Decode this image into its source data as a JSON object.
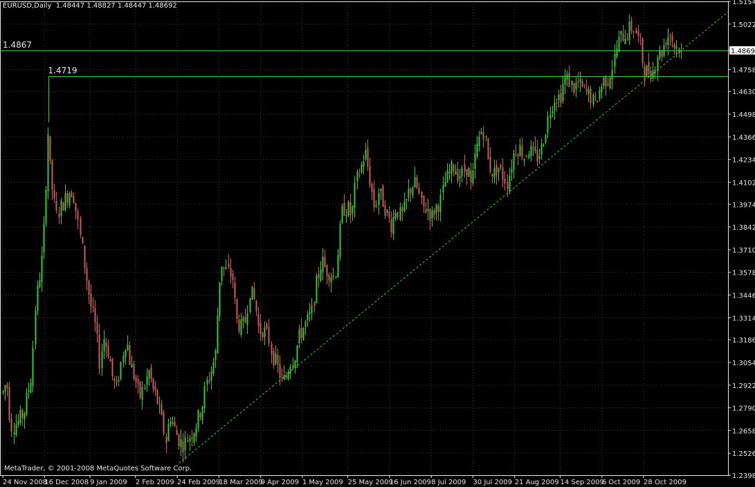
{
  "header": {
    "symbol": "EURUSD,Daily",
    "ohlc": "1.48447 1.48827 1.48447 1.48692"
  },
  "footer": {
    "copyright": "MetaTrader, © 2001-2008 MetaQuotes Software Corp."
  },
  "colors": {
    "background": "#000000",
    "grid": "#3a3a3a",
    "axis_text": "#e8e8e8",
    "bull_candle": "#32cd32",
    "bear_candle": "#d45a5a",
    "level_line": "#2fd62f",
    "trendline": "#2fd62f"
  },
  "chart_data": {
    "type": "candlestick",
    "symbol": "EURUSD",
    "timeframe": "Daily",
    "ylim": [
      1.2398,
      1.5154
    ],
    "current_price": "1.48692",
    "grid": true,
    "y_ticks": [
      "1.51540",
      "1.50220",
      "1.48692",
      "1.47580",
      "1.46300",
      "1.44980",
      "1.43660",
      "1.42340",
      "1.41020",
      "1.39740",
      "1.38420",
      "1.37100",
      "1.35780",
      "1.34460",
      "1.33140",
      "1.31860",
      "1.30540",
      "1.29220",
      "1.27900",
      "1.26580",
      "1.25260",
      "1.23980"
    ],
    "x_ticks": [
      "24 Nov 2008",
      "16 Dec 2008",
      "9 Jan 2009",
      "2 Feb 2009",
      "24 Feb 2009",
      "18 Mar 2009",
      "9 Apr 2009",
      "1 May 2009",
      "25 May 2009",
      "16 Jun 2009",
      "8 Jul 2009",
      "30 Jul 2009",
      "21 Aug 2009",
      "14 Sep 2009",
      "6 Oct 2009",
      "28 Oct 2009"
    ],
    "horizontal_levels": [
      {
        "label": "1.4867",
        "value": 1.4867,
        "from_date": "24 Nov 2008"
      },
      {
        "label": "1.4719",
        "value": 1.4719,
        "from_date": "18 Dec 2008"
      }
    ],
    "trendline": {
      "style": "dashed",
      "start": {
        "date": "25 Feb 2009",
        "price": 1.2468
      },
      "end": {
        "date": "17 Nov 2009",
        "price": 1.487
      }
    },
    "close_path": [
      [
        "24 Nov 2008",
        1.288
      ],
      [
        "26 Nov 2008",
        1.295
      ],
      [
        "28 Nov 2008",
        1.268
      ],
      [
        "2 Dec 2008",
        1.271
      ],
      [
        "5 Dec 2008",
        1.276
      ],
      [
        "9 Dec 2008",
        1.298
      ],
      [
        "11 Dec 2008",
        1.338
      ],
      [
        "15 Dec 2008",
        1.37
      ],
      [
        "17 Dec 2008",
        1.42
      ],
      [
        "18 Dec 2008",
        1.445
      ],
      [
        "19 Dec 2008",
        1.415
      ],
      [
        "22 Dec 2008",
        1.39
      ],
      [
        "24 Dec 2008",
        1.395
      ],
      [
        "29 Dec 2008",
        1.405
      ],
      [
        "31 Dec 2008",
        1.405
      ],
      [
        "2 Jan 2009",
        1.39
      ],
      [
        "5 Jan 2009",
        1.37
      ],
      [
        "7 Jan 2009",
        1.355
      ],
      [
        "9 Jan 2009",
        1.34
      ],
      [
        "12 Jan 2009",
        1.325
      ],
      [
        "14 Jan 2009",
        1.305
      ],
      [
        "16 Jan 2009",
        1.32
      ],
      [
        "19 Jan 2009",
        1.31
      ],
      [
        "21 Jan 2009",
        1.295
      ],
      [
        "23 Jan 2009",
        1.29
      ],
      [
        "26 Jan 2009",
        1.31
      ],
      [
        "28 Jan 2009",
        1.32
      ],
      [
        "30 Jan 2009",
        1.305
      ],
      [
        "2 Feb 2009",
        1.295
      ],
      [
        "4 Feb 2009",
        1.285
      ],
      [
        "6 Feb 2009",
        1.29
      ],
      [
        "9 Feb 2009",
        1.3
      ],
      [
        "11 Feb 2009",
        1.29
      ],
      [
        "13 Feb 2009",
        1.285
      ],
      [
        "16 Feb 2009",
        1.27
      ],
      [
        "18 Feb 2009",
        1.26
      ],
      [
        "20 Feb 2009",
        1.275
      ],
      [
        "23 Feb 2009",
        1.265
      ],
      [
        "25 Feb 2009",
        1.26
      ],
      [
        "27 Feb 2009",
        1.258
      ],
      [
        "2 Mar 2009",
        1.262
      ],
      [
        "4 Mar 2009",
        1.265
      ],
      [
        "6 Mar 2009",
        1.27
      ],
      [
        "9 Mar 2009",
        1.28
      ],
      [
        "11 Mar 2009",
        1.292
      ],
      [
        "13 Mar 2009",
        1.298
      ],
      [
        "16 Mar 2009",
        1.31
      ],
      [
        "18 Mar 2009",
        1.35
      ],
      [
        "19 Mar 2009",
        1.365
      ],
      [
        "20 Mar 2009",
        1.36
      ],
      [
        "23 Mar 2009",
        1.358
      ],
      [
        "25 Mar 2009",
        1.355
      ],
      [
        "27 Mar 2009",
        1.33
      ],
      [
        "30 Mar 2009",
        1.325
      ],
      [
        "1 Apr 2009",
        1.33
      ],
      [
        "3 Apr 2009",
        1.348
      ],
      [
        "6 Apr 2009",
        1.34
      ],
      [
        "8 Apr 2009",
        1.323
      ],
      [
        "10 Apr 2009",
        1.325
      ],
      [
        "13 Apr 2009",
        1.32
      ],
      [
        "15 Apr 2009",
        1.31
      ],
      [
        "17 Apr 2009",
        1.305
      ],
      [
        "20 Apr 2009",
        1.295
      ],
      [
        "22 Apr 2009",
        1.295
      ],
      [
        "24 Apr 2009",
        1.305
      ],
      [
        "27 Apr 2009",
        1.31
      ],
      [
        "29 Apr 2009",
        1.32
      ],
      [
        "1 May 2009",
        1.325
      ],
      [
        "4 May 2009",
        1.33
      ],
      [
        "6 May 2009",
        1.335
      ],
      [
        "8 May 2009",
        1.35
      ],
      [
        "11 May 2009",
        1.365
      ],
      [
        "13 May 2009",
        1.36
      ],
      [
        "15 May 2009",
        1.358
      ],
      [
        "18 May 2009",
        1.355
      ],
      [
        "20 May 2009",
        1.375
      ],
      [
        "22 May 2009",
        1.395
      ],
      [
        "25 May 2009",
        1.395
      ],
      [
        "27 May 2009",
        1.39
      ],
      [
        "29 May 2009",
        1.41
      ],
      [
        "1 Jun 2009",
        1.42
      ],
      [
        "3 Jun 2009",
        1.428
      ],
      [
        "5 Jun 2009",
        1.415
      ],
      [
        "8 Jun 2009",
        1.395
      ],
      [
        "10 Jun 2009",
        1.405
      ],
      [
        "12 Jun 2009",
        1.4
      ],
      [
        "15 Jun 2009",
        1.39
      ],
      [
        "17 Jun 2009",
        1.385
      ],
      [
        "19 Jun 2009",
        1.395
      ],
      [
        "22 Jun 2009",
        1.39
      ],
      [
        "24 Jun 2009",
        1.395
      ],
      [
        "26 Jun 2009",
        1.405
      ],
      [
        "29 Jun 2009",
        1.41
      ],
      [
        "1 Jul 2009",
        1.405
      ],
      [
        "3 Jul 2009",
        1.395
      ],
      [
        "6 Jul 2009",
        1.395
      ],
      [
        "8 Jul 2009",
        1.39
      ],
      [
        "10 Jul 2009",
        1.395
      ],
      [
        "13 Jul 2009",
        1.4
      ],
      [
        "15 Jul 2009",
        1.41
      ],
      [
        "17 Jul 2009",
        1.415
      ],
      [
        "20 Jul 2009",
        1.42
      ],
      [
        "22 Jul 2009",
        1.415
      ],
      [
        "24 Jul 2009",
        1.415
      ],
      [
        "27 Jul 2009",
        1.42
      ],
      [
        "29 Jul 2009",
        1.405
      ],
      [
        "31 Jul 2009",
        1.425
      ],
      [
        "3 Aug 2009",
        1.44
      ],
      [
        "5 Aug 2009",
        1.44
      ],
      [
        "7 Aug 2009",
        1.42
      ],
      [
        "10 Aug 2009",
        1.415
      ],
      [
        "12 Aug 2009",
        1.42
      ],
      [
        "14 Aug 2009",
        1.415
      ],
      [
        "17 Aug 2009",
        1.41
      ],
      [
        "19 Aug 2009",
        1.42
      ],
      [
        "21 Aug 2009",
        1.43
      ],
      [
        "24 Aug 2009",
        1.43
      ],
      [
        "26 Aug 2009",
        1.425
      ],
      [
        "28 Aug 2009",
        1.43
      ],
      [
        "31 Aug 2009",
        1.425
      ],
      [
        "2 Sep 2009",
        1.425
      ],
      [
        "4 Sep 2009",
        1.43
      ],
      [
        "7 Sep 2009",
        1.445
      ],
      [
        "9 Sep 2009",
        1.455
      ],
      [
        "11 Sep 2009",
        1.46
      ],
      [
        "14 Sep 2009",
        1.46
      ],
      [
        "16 Sep 2009",
        1.47
      ],
      [
        "18 Sep 2009",
        1.47
      ],
      [
        "21 Sep 2009",
        1.465
      ],
      [
        "23 Sep 2009",
        1.468
      ],
      [
        "25 Sep 2009",
        1.465
      ],
      [
        "28 Sep 2009",
        1.462
      ],
      [
        "30 Sep 2009",
        1.46
      ],
      [
        "2 Oct 2009",
        1.455
      ],
      [
        "5 Oct 2009",
        1.465
      ],
      [
        "7 Oct 2009",
        1.47
      ],
      [
        "9 Oct 2009",
        1.47
      ],
      [
        "12 Oct 2009",
        1.48
      ],
      [
        "14 Oct 2009",
        1.49
      ],
      [
        "16 Oct 2009",
        1.495
      ],
      [
        "19 Oct 2009",
        1.497
      ],
      [
        "21 Oct 2009",
        1.5
      ],
      [
        "23 Oct 2009",
        1.5
      ],
      [
        "26 Oct 2009",
        1.49
      ],
      [
        "28 Oct 2009",
        1.475
      ],
      [
        "30 Oct 2009",
        1.475
      ],
      [
        "2 Nov 2009",
        1.475
      ],
      [
        "4 Nov 2009",
        1.485
      ],
      [
        "6 Nov 2009",
        1.485
      ],
      [
        "9 Nov 2009",
        1.495
      ],
      [
        "11 Nov 2009",
        1.497
      ],
      [
        "13 Nov 2009",
        1.49
      ],
      [
        "16 Nov 2009",
        1.488
      ],
      [
        "17 Nov 2009",
        1.48692
      ]
    ]
  }
}
